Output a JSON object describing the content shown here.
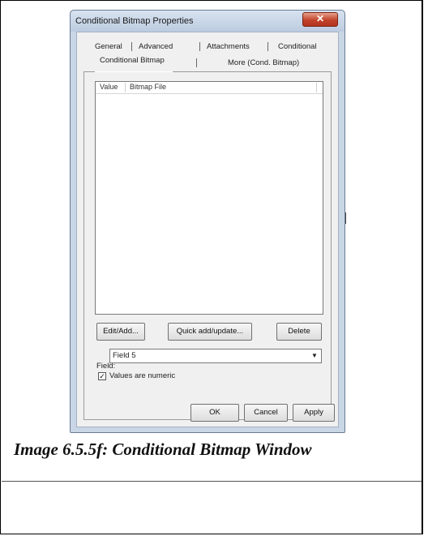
{
  "dialog": {
    "title": "Conditional Bitmap Properties",
    "close_glyph": "✕",
    "tabs_row1": [
      "General",
      "Advanced",
      "Attachments",
      "Conditional"
    ],
    "tabs_row2": [
      "Conditional Bitmap",
      "More (Cond. Bitmap)"
    ],
    "active_tab": "Conditional Bitmap",
    "list": {
      "columns": [
        "Value",
        "Bitmap File"
      ],
      "rows": []
    },
    "buttons": {
      "edit_add": "Edit/Add...",
      "quick_add": "Quick add/update...",
      "delete": "Delete"
    },
    "field": {
      "label": "Field:",
      "value": "Field 5"
    },
    "checkbox": {
      "label": "Values are numeric",
      "checked": true,
      "mark": "✓"
    },
    "footer": {
      "ok": "OK",
      "cancel": "Cancel",
      "apply": "Apply"
    }
  },
  "caption": "Image 6.5.5f: Conditional Bitmap Window",
  "colors": {
    "window_frame": "#c9d6e6",
    "close_button": "#c2432a",
    "client_bg": "#f0f0f0"
  }
}
